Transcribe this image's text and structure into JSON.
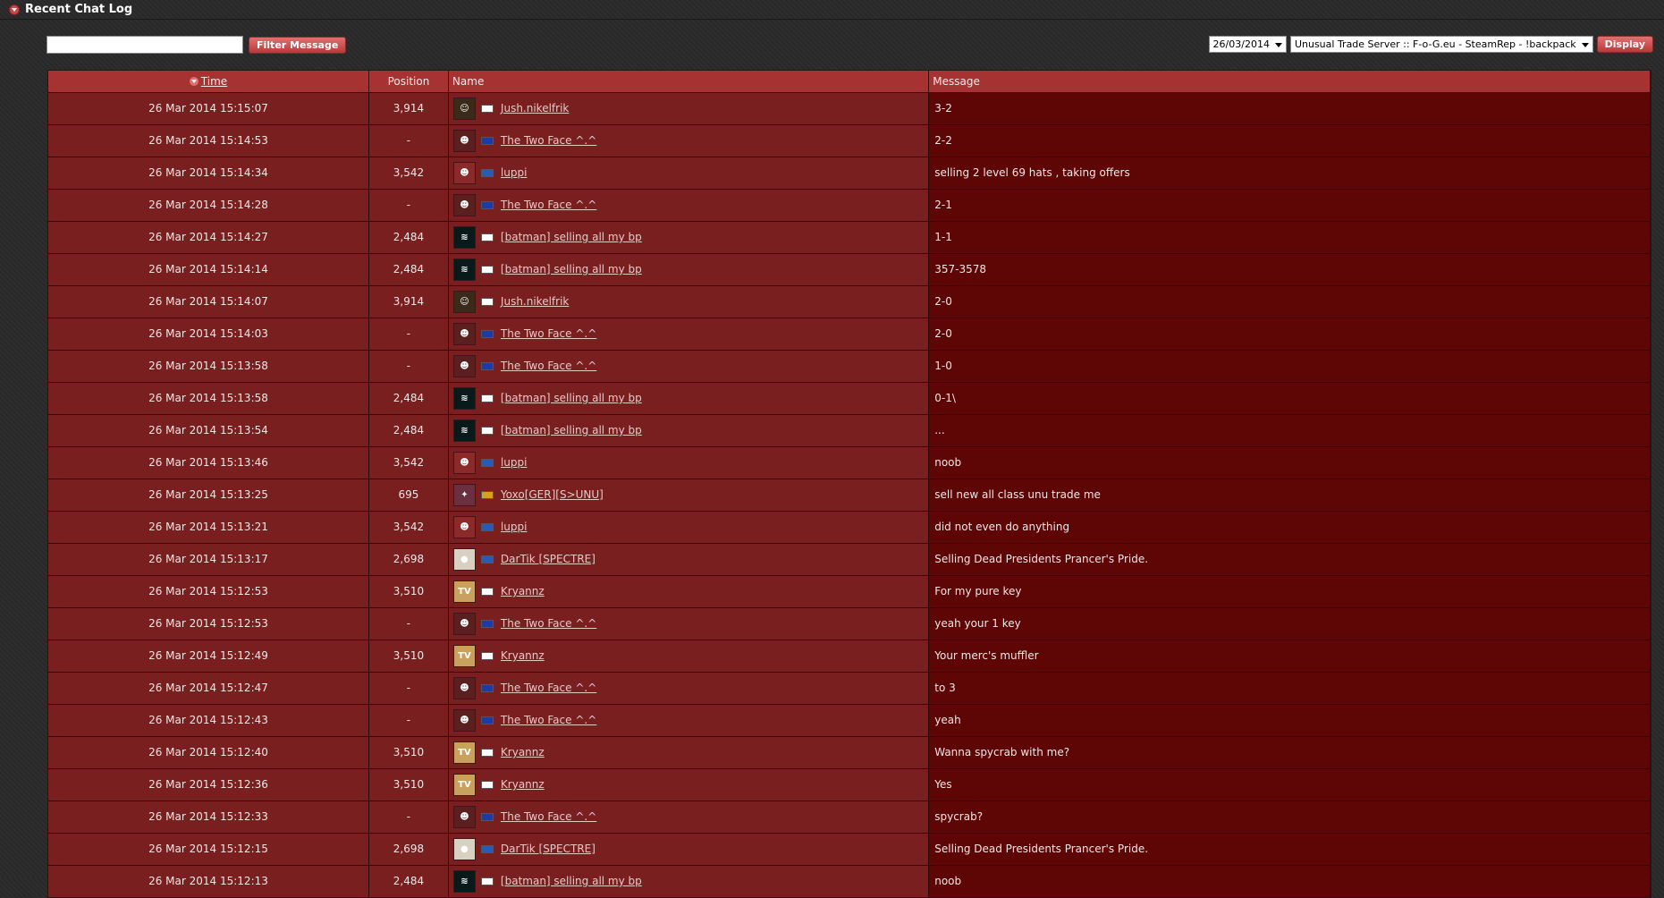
{
  "header": {
    "title": "Recent Chat Log"
  },
  "filter": {
    "input_value": "",
    "button_label": "Filter Message"
  },
  "server_bar": {
    "date_value": "26/03/2014",
    "server_value": "Unusual Trade Server :: F-o-G.eu - SteamRep - !backpack",
    "display_label": "Display"
  },
  "columns": {
    "time": "Time",
    "position": "Position",
    "name": "Name",
    "message": "Message"
  },
  "colors": {
    "avatar_twoface": "#5a2020",
    "avatar_jush": "#3a2a1a",
    "avatar_luppi": "#8a2a2a",
    "avatar_batman": "#0a1a1a",
    "avatar_yoxo": "#6a3040",
    "avatar_dartik": "#d8d0c0",
    "avatar_kryannz": "#c8a060",
    "flag_il": "#ffffff",
    "flag_ba": "#1c3aa8",
    "flag_se": "#2a5ab8",
    "flag_de": "#d8a020",
    "flag_ua": "#2a5ab8"
  },
  "rows": [
    {
      "time": "26 Mar 2014 15:15:07",
      "pos": "3,914",
      "name": "Jush.nikelfrik",
      "msg": "3-2",
      "av": "jush",
      "flag": "il"
    },
    {
      "time": "26 Mar 2014 15:14:53",
      "pos": "-",
      "name": "The Two Face ^.^",
      "msg": "2-2",
      "av": "twoface",
      "flag": "ba"
    },
    {
      "time": "26 Mar 2014 15:14:34",
      "pos": "3,542",
      "name": "luppi",
      "msg": "selling 2 level 69 hats , taking offers",
      "av": "luppi",
      "flag": "se"
    },
    {
      "time": "26 Mar 2014 15:14:28",
      "pos": "-",
      "name": "The Two Face ^.^",
      "msg": "2-1",
      "av": "twoface",
      "flag": "ba"
    },
    {
      "time": "26 Mar 2014 15:14:27",
      "pos": "2,484",
      "name": "[batman] selling all my bp",
      "msg": "1-1",
      "av": "batman",
      "flag": "il"
    },
    {
      "time": "26 Mar 2014 15:14:14",
      "pos": "2,484",
      "name": "[batman] selling all my bp",
      "msg": "357-3578",
      "av": "batman",
      "flag": "il"
    },
    {
      "time": "26 Mar 2014 15:14:07",
      "pos": "3,914",
      "name": "Jush.nikelfrik",
      "msg": "2-0",
      "av": "jush",
      "flag": "il"
    },
    {
      "time": "26 Mar 2014 15:14:03",
      "pos": "-",
      "name": "The Two Face ^.^",
      "msg": "2-0",
      "av": "twoface",
      "flag": "ba"
    },
    {
      "time": "26 Mar 2014 15:13:58",
      "pos": "-",
      "name": "The Two Face ^.^",
      "msg": "1-0",
      "av": "twoface",
      "flag": "ba"
    },
    {
      "time": "26 Mar 2014 15:13:58",
      "pos": "2,484",
      "name": "[batman] selling all my bp",
      "msg": "0-1\\",
      "av": "batman",
      "flag": "il"
    },
    {
      "time": "26 Mar 2014 15:13:54",
      "pos": "2,484",
      "name": "[batman] selling all my bp",
      "msg": "...",
      "av": "batman",
      "flag": "il"
    },
    {
      "time": "26 Mar 2014 15:13:46",
      "pos": "3,542",
      "name": "luppi",
      "msg": "noob",
      "av": "luppi",
      "flag": "se"
    },
    {
      "time": "26 Mar 2014 15:13:25",
      "pos": "695",
      "name": "Yoxo[GER][S>UNU]",
      "msg": "sell new all class unu trade me",
      "av": "yoxo",
      "flag": "de"
    },
    {
      "time": "26 Mar 2014 15:13:21",
      "pos": "3,542",
      "name": "luppi",
      "msg": "did not even do anything",
      "av": "luppi",
      "flag": "se"
    },
    {
      "time": "26 Mar 2014 15:13:17",
      "pos": "2,698",
      "name": "DarTik [SPECTRE]",
      "msg": "Selling Dead Presidents Prancer's Pride.",
      "av": "dartik",
      "flag": "ua"
    },
    {
      "time": "26 Mar 2014 15:12:53",
      "pos": "3,510",
      "name": "Kryannz",
      "msg": "For my pure key",
      "av": "kryannz",
      "flag": "il"
    },
    {
      "time": "26 Mar 2014 15:12:53",
      "pos": "-",
      "name": "The Two Face ^.^",
      "msg": "yeah your 1 key",
      "av": "twoface",
      "flag": "ba"
    },
    {
      "time": "26 Mar 2014 15:12:49",
      "pos": "3,510",
      "name": "Kryannz",
      "msg": "Your merc's muffler",
      "av": "kryannz",
      "flag": "il"
    },
    {
      "time": "26 Mar 2014 15:12:47",
      "pos": "-",
      "name": "The Two Face ^.^",
      "msg": "to 3",
      "av": "twoface",
      "flag": "ba"
    },
    {
      "time": "26 Mar 2014 15:12:43",
      "pos": "-",
      "name": "The Two Face ^.^",
      "msg": "yeah",
      "av": "twoface",
      "flag": "ba"
    },
    {
      "time": "26 Mar 2014 15:12:40",
      "pos": "3,510",
      "name": "Kryannz",
      "msg": "Wanna spycrab with me?",
      "av": "kryannz",
      "flag": "il"
    },
    {
      "time": "26 Mar 2014 15:12:36",
      "pos": "3,510",
      "name": "Kryannz",
      "msg": "Yes",
      "av": "kryannz",
      "flag": "il"
    },
    {
      "time": "26 Mar 2014 15:12:33",
      "pos": "-",
      "name": "The Two Face ^.^",
      "msg": "spycrab?",
      "av": "twoface",
      "flag": "ba"
    },
    {
      "time": "26 Mar 2014 15:12:15",
      "pos": "2,698",
      "name": "DarTik [SPECTRE]",
      "msg": "Selling Dead Presidents Prancer's Pride.",
      "av": "dartik",
      "flag": "ua"
    },
    {
      "time": "26 Mar 2014 15:12:13",
      "pos": "2,484",
      "name": "[batman] selling all my bp",
      "msg": "noob",
      "av": "batman",
      "flag": "il"
    }
  ]
}
